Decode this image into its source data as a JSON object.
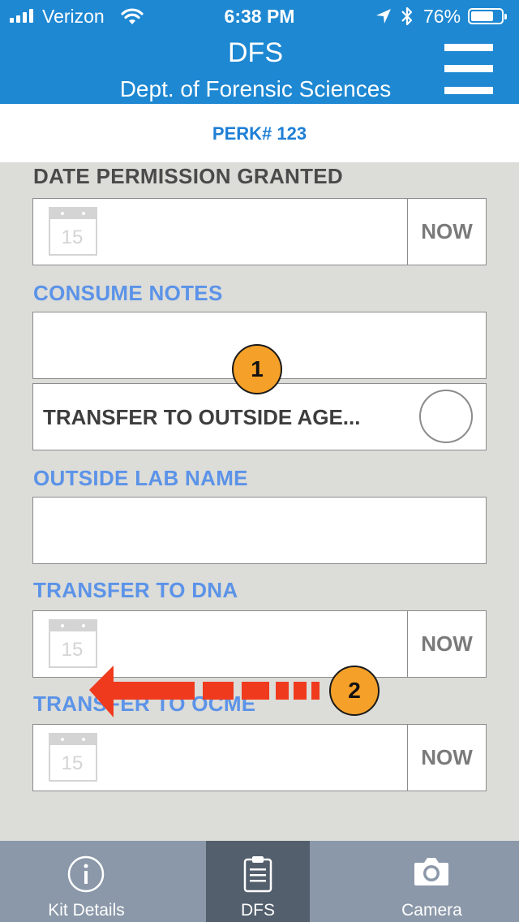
{
  "status_bar": {
    "carrier": "Verizon",
    "time": "6:38 PM",
    "battery_percent": "76%",
    "battery_level": 0.76
  },
  "header": {
    "title": "DFS",
    "subtitle": "Dept. of Forensic Sciences"
  },
  "perk": {
    "label": "PERK# 123"
  },
  "form": {
    "date_permission_granted": {
      "label": "DATE PERMISSION GRANTED",
      "calendar_day": "15",
      "now_label": "NOW"
    },
    "consume_notes": {
      "label": "CONSUME NOTES",
      "value": ""
    },
    "transfer_outside_agency": {
      "label": "TRANSFER TO OUTSIDE AGE..."
    },
    "outside_lab_name": {
      "label": "OUTSIDE LAB NAME",
      "value": ""
    },
    "transfer_to_dna": {
      "label": "TRANSFER TO DNA",
      "calendar_day": "15",
      "now_label": "NOW"
    },
    "transfer_to_ocme": {
      "label": "TRANSFER TO OCME",
      "calendar_day": "15",
      "now_label": "NOW"
    }
  },
  "annotations": {
    "badge_1": "1",
    "badge_2": "2"
  },
  "tabs": [
    {
      "label": "Kit Details",
      "icon": "info-icon"
    },
    {
      "label": "DFS",
      "icon": "clipboard-icon",
      "active": true
    },
    {
      "label": "Camera",
      "icon": "camera-icon"
    }
  ],
  "colors": {
    "header_bg": "#1e88d2",
    "label_blue": "#5b93e8",
    "tab_bg": "#8b98a9",
    "tab_active": "#545f6d",
    "badge": "#f5a028",
    "arrow": "#f03a1e"
  }
}
